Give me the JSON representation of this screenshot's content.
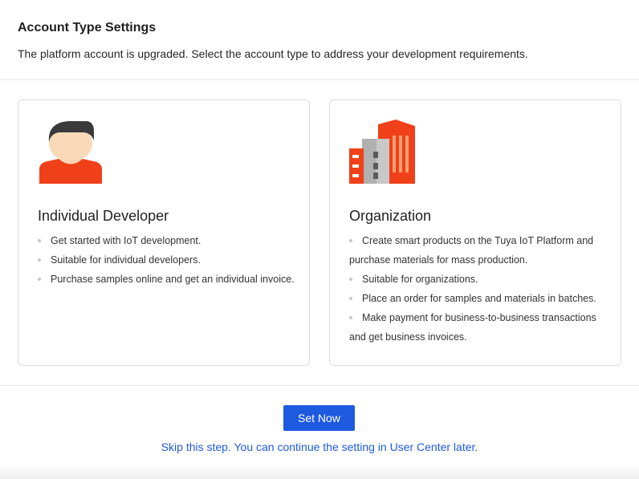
{
  "header": {
    "title": "Account Type Settings",
    "description": "The platform account is upgraded. Select the account type to address your development requirements."
  },
  "cards": {
    "individual": {
      "title": "Individual Developer",
      "icon": "person-icon",
      "items": [
        "Get started with IoT development.",
        "Suitable for individual developers.",
        "Purchase samples online and get an individual invoice."
      ]
    },
    "organization": {
      "title": "Organization",
      "icon": "building-icon",
      "items": [
        "Create smart products on the Tuya IoT Platform and purchase materials for mass production.",
        "Suitable for organizations.",
        "Place an order for samples and materials in batches.",
        "Make payment for business-to-business transactions and get business invoices."
      ]
    }
  },
  "footer": {
    "set_now_label": "Set Now",
    "skip_text": "Skip this step. You can continue the setting in User Center later."
  },
  "colors": {
    "primary": "#1e5ae0",
    "accent": "#f04a1c"
  }
}
